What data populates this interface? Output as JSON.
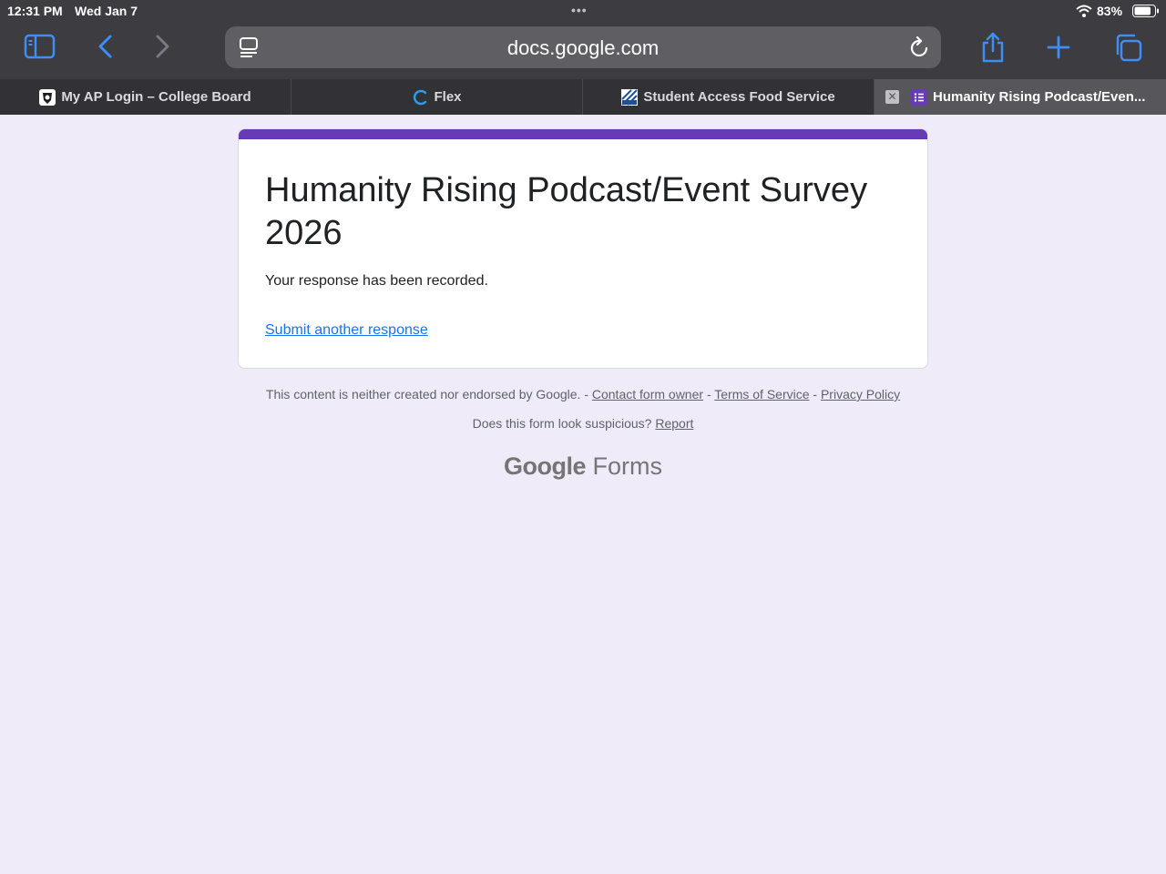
{
  "status": {
    "time": "12:31 PM",
    "date": "Wed Jan 7",
    "battery": "83%"
  },
  "toolbar": {
    "url": "docs.google.com"
  },
  "tabs": [
    {
      "label": "My AP Login – College Board",
      "icon": "college-board-icon"
    },
    {
      "label": "Flex",
      "icon": "flex-icon"
    },
    {
      "label": "Student Access Food Service",
      "icon": "food-service-icon"
    },
    {
      "label": "Humanity Rising Podcast/Even...",
      "icon": "google-forms-icon",
      "active": true
    }
  ],
  "form": {
    "title": "Humanity Rising Podcast/Event Survey 2026",
    "message": "Your response has been recorded.",
    "another_link": "Submit another response"
  },
  "footer": {
    "disclaimer": "This content is neither created nor endorsed by Google. -",
    "contact": "Contact form owner",
    "sep1": "-",
    "terms": "Terms of Service",
    "sep2": "-",
    "privacy": "Privacy Policy",
    "suspicious": "Does this form look suspicious?",
    "report": "Report",
    "logo_google": "Google",
    "logo_forms": "Forms"
  },
  "colors": {
    "accent": "#673ab7",
    "link": "#1a73e8",
    "page_bg": "#f0ebf8",
    "safari_blue": "#3f8ef7"
  }
}
